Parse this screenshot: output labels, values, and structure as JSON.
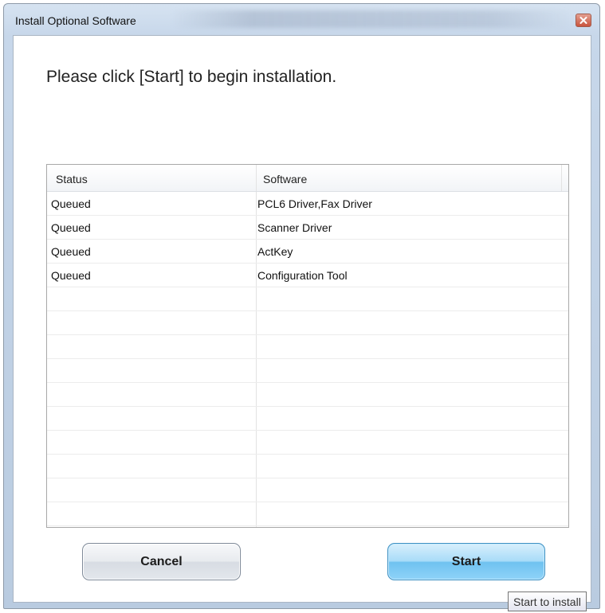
{
  "window": {
    "title": "Install Optional Software",
    "close_icon": "close-icon"
  },
  "main": {
    "instruction": "Please click [Start] to begin installation."
  },
  "list": {
    "columns": [
      "Status",
      "Software"
    ],
    "rows": [
      {
        "status": "Queued",
        "software": "PCL6 Driver,Fax Driver"
      },
      {
        "status": "Queued",
        "software": "Scanner Driver"
      },
      {
        "status": "Queued",
        "software": "ActKey"
      },
      {
        "status": "Queued",
        "software": "Configuration Tool"
      }
    ],
    "empty_rows": 10
  },
  "buttons": {
    "cancel_label": "Cancel",
    "start_label": "Start"
  },
  "tooltip": {
    "text": "Start to install"
  }
}
